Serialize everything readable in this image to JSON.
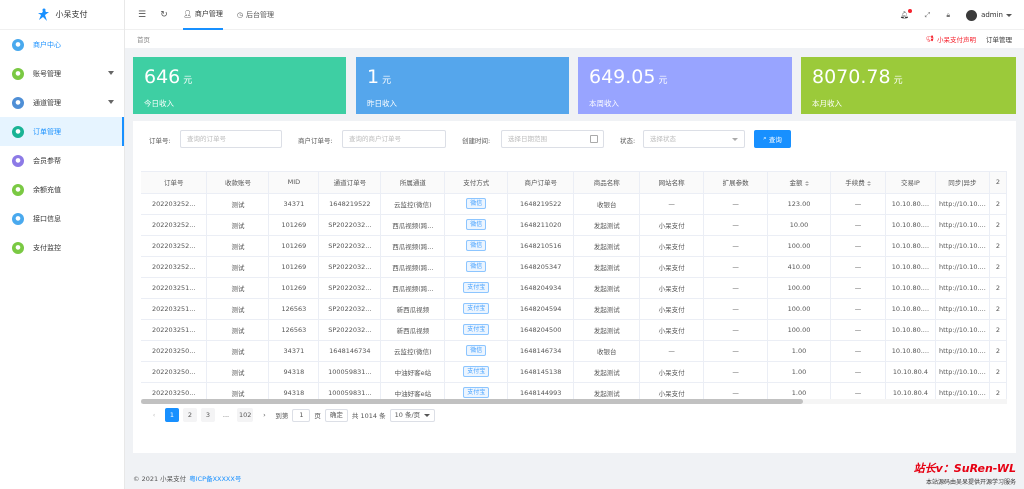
{
  "app": {
    "name": "小呆支付"
  },
  "colors": {
    "primary": "#1890ff",
    "card1": "#3ecfa3",
    "card2": "#55a6ec",
    "card3": "#98a4ff",
    "card4": "#9bca3a",
    "danger": "#e60012"
  },
  "sidebar": {
    "items": [
      {
        "label": "商户中心",
        "icon": "user-center-icon",
        "color": "#49a9ee",
        "active": true,
        "arrow": false
      },
      {
        "label": "账号管理",
        "icon": "account-icon",
        "color": "#7ac943",
        "active": false,
        "arrow": true
      },
      {
        "label": "通道管理",
        "icon": "channel-icon",
        "color": "#4f8fd6",
        "active": false,
        "arrow": true
      },
      {
        "label": "订单管理",
        "icon": "cart-icon",
        "color": "#1ab394",
        "active": true,
        "arrow": false
      },
      {
        "label": "会员参帮",
        "icon": "member-icon",
        "color": "#8c7ae6",
        "active": false,
        "arrow": false
      },
      {
        "label": "余额充值",
        "icon": "recharge-icon",
        "color": "#7ac943",
        "active": false,
        "arrow": false
      },
      {
        "label": "接口信息",
        "icon": "api-icon",
        "color": "#49a9ee",
        "active": false,
        "arrow": false
      },
      {
        "label": "支付监控",
        "icon": "monitor-icon",
        "color": "#7ac943",
        "active": false,
        "arrow": false
      }
    ]
  },
  "header": {
    "tabs": [
      {
        "label": "商户管理",
        "icon": "user-icon"
      },
      {
        "label": "后台管理",
        "icon": "dashboard-icon"
      }
    ],
    "username": "admin"
  },
  "breadcrumb": {
    "home": "首页",
    "notice": "小呆支付声明",
    "current": "订单管理"
  },
  "stats": [
    {
      "value": "646",
      "unit": "元",
      "label": "今日收入"
    },
    {
      "value": "1",
      "unit": "元",
      "label": "昨日收入"
    },
    {
      "value": "649.05",
      "unit": "元",
      "label": "本周收入"
    },
    {
      "value": "8070.78",
      "unit": "元",
      "label": "本月收入"
    }
  ],
  "filters": {
    "order_no_label": "订单号:",
    "order_no_placeholder": "查询的订单号",
    "merchant_no_label": "商户订单号:",
    "merchant_no_placeholder": "查询的商户订单号",
    "created_label": "创建时间:",
    "created_placeholder": "选择日期范围",
    "status_label": "状态:",
    "status_placeholder": "选择状态",
    "search_label": "查询"
  },
  "table": {
    "columns": [
      "订单号",
      "收款账号",
      "MID",
      "通道订单号",
      "所属通道",
      "支付方式",
      "商户订单号",
      "商品名称",
      "网站名称",
      "扩展参数",
      "金额",
      "手续费",
      "交易IP",
      "同步|异步",
      "2"
    ],
    "rows": [
      [
        "202203252...",
        "测试",
        "34371",
        "1648219522",
        "云监控(微信)",
        "微信",
        "1648219522",
        "收银台",
        "—",
        "—",
        "123.00",
        "—",
        "10.10.80....",
        "http://10.10....",
        "2"
      ],
      [
        "202203252...",
        "测试",
        "101269",
        "SP2022032...",
        "西瓜视频(跨...",
        "微信",
        "1648211020",
        "发起测试",
        "小呆支付",
        "—",
        "10.00",
        "—",
        "10.10.80....",
        "http://10.10....",
        "2"
      ],
      [
        "202203252...",
        "测试",
        "101269",
        "SP2022032...",
        "西瓜视频(跨...",
        "微信",
        "1648210516",
        "发起测试",
        "小呆支付",
        "—",
        "100.00",
        "—",
        "10.10.80....",
        "http://10.10....",
        "2"
      ],
      [
        "202203252...",
        "测试",
        "101269",
        "SP2022032...",
        "西瓜视频(跨...",
        "微信",
        "1648205347",
        "发起测试",
        "小呆支付",
        "—",
        "410.00",
        "—",
        "10.10.80....",
        "http://10.10....",
        "2"
      ],
      [
        "202203251...",
        "测试",
        "101269",
        "SP2022032...",
        "西瓜视频(跨...",
        "支付宝",
        "1648204934",
        "发起测试",
        "小呆支付",
        "—",
        "100.00",
        "—",
        "10.10.80....",
        "http://10.10....",
        "2"
      ],
      [
        "202203251...",
        "测试",
        "126563",
        "SP2022032...",
        "新西瓜视频",
        "支付宝",
        "1648204594",
        "发起测试",
        "小呆支付",
        "—",
        "100.00",
        "—",
        "10.10.80....",
        "http://10.10....",
        "2"
      ],
      [
        "202203251...",
        "测试",
        "126563",
        "SP2022032...",
        "新西瓜视频",
        "支付宝",
        "1648204500",
        "发起测试",
        "小呆支付",
        "—",
        "100.00",
        "—",
        "10.10.80....",
        "http://10.10....",
        "2"
      ],
      [
        "202203250...",
        "测试",
        "34371",
        "1648146734",
        "云监控(微信)",
        "微信",
        "1648146734",
        "收银台",
        "—",
        "—",
        "1.00",
        "—",
        "10.10.80....",
        "http://10.10....",
        "2"
      ],
      [
        "202203250...",
        "测试",
        "94318",
        "100059831...",
        "中油好客e站",
        "支付宝",
        "1648145138",
        "发起测试",
        "小呆支付",
        "—",
        "1.00",
        "—",
        "10.10.80.4",
        "http://10.10....",
        "2"
      ],
      [
        "202203250...",
        "测试",
        "94318",
        "100059831...",
        "中油好客e站",
        "支付宝",
        "1648144993",
        "发起测试",
        "小呆支付",
        "—",
        "1.00",
        "—",
        "10.10.80.4",
        "http://10.10....",
        "2"
      ]
    ]
  },
  "pagination": {
    "pages": [
      "1",
      "2",
      "3",
      "...",
      "102"
    ],
    "goto_label": "到第",
    "goto_value": "1",
    "page_suffix": "页",
    "confirm": "确定",
    "total": "共 1014 条",
    "page_size": "10 条/页"
  },
  "footer": {
    "copyright": "© 2021 小呆支付",
    "icp": "粤ICP备XXXXX号"
  },
  "watermark": {
    "line1": "站长v：SuRen-WL",
    "line2": "本站源码由吴呆提供开源学习服务"
  }
}
